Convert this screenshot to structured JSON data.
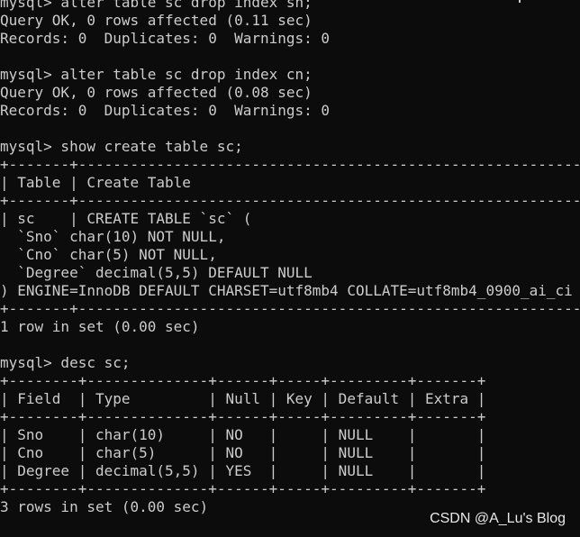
{
  "terminal": {
    "lines": [
      "mysql> alter table sc drop index sn;",
      "Query OK, 0 rows affected (0.11 sec)",
      "Records: 0  Duplicates: 0  Warnings: 0",
      "",
      "mysql> alter table sc drop index cn;",
      "Query OK, 0 rows affected (0.08 sec)",
      "Records: 0  Duplicates: 0  Warnings: 0",
      "",
      "mysql> show create table sc;",
      "+-------+---------------------------------------------------------------------------------------------------+",
      "| Table | Create Table                                                                                      |",
      "+-------+---------------------------------------------------------------------------------------------------+",
      "| sc    | CREATE TABLE `sc` (",
      "  `Sno` char(10) NOT NULL,",
      "  `Cno` char(5) NOT NULL,",
      "  `Degree` decimal(5,5) DEFAULT NULL",
      ") ENGINE=InnoDB DEFAULT CHARSET=utf8mb4 COLLATE=utf8mb4_0900_ai_ci |",
      "+-------+---------------------------------------------------------------------------------------------------+",
      "1 row in set (0.00 sec)",
      "",
      "mysql> desc sc;",
      "+--------+--------------+------+-----+---------+-------+",
      "| Field  | Type         | Null | Key | Default | Extra |",
      "+--------+--------------+------+-----+---------+-------+",
      "| Sno    | char(10)     | NO   |     | NULL    |       |",
      "| Cno    | char(5)      | NO   |     | NULL    |       |",
      "| Degree | decimal(5,5) | YES  |     | NULL    |       |",
      "+--------+--------------+------+-----+---------+-------+",
      "3 rows in set (0.00 sec)"
    ]
  },
  "watermark": {
    "text": "CSDN @A_Lu's Blog"
  }
}
